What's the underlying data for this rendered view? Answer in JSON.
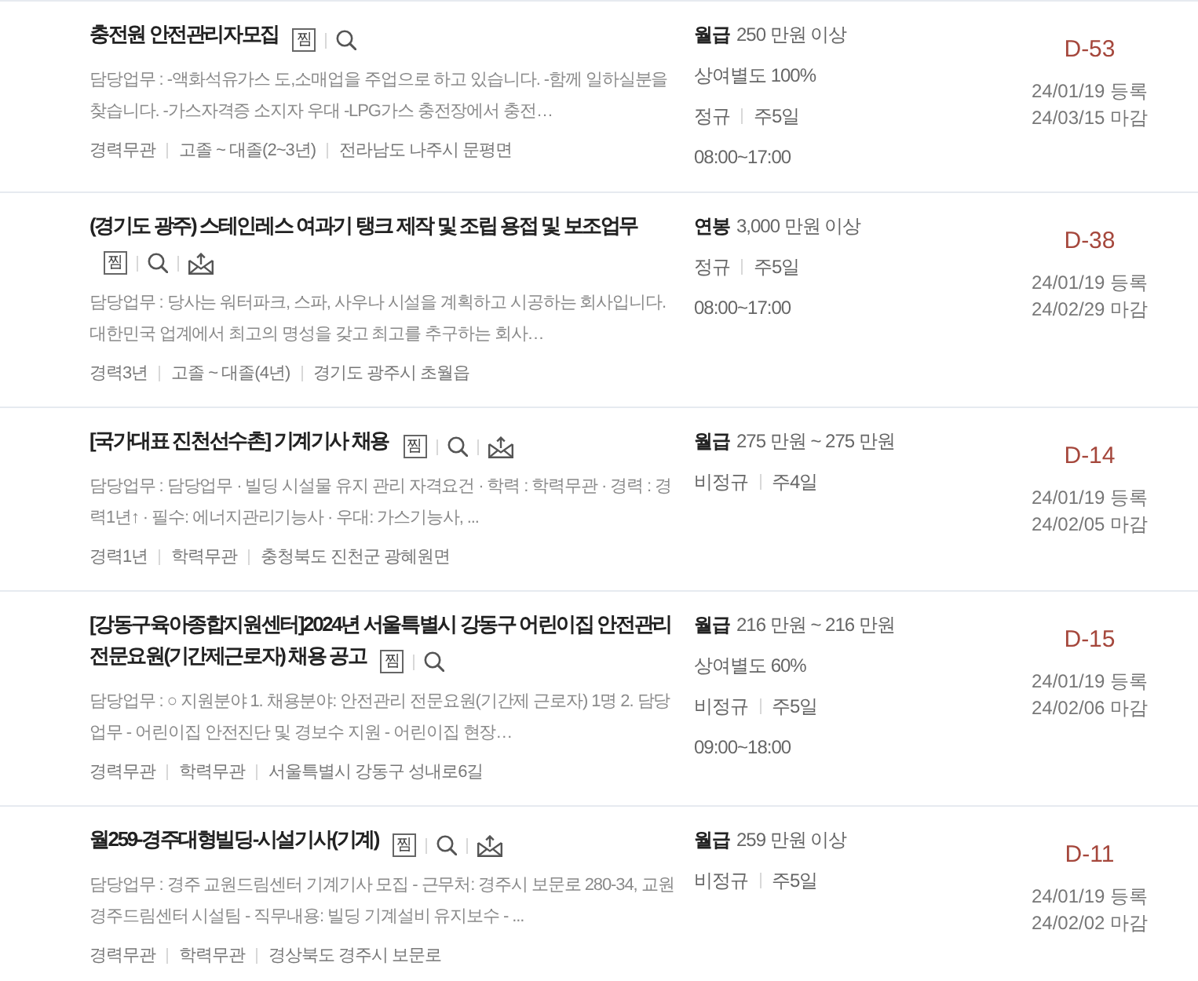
{
  "listings": [
    {
      "title": "충전원 안전관리자모집",
      "actions": [
        {
          "kind": "scrap",
          "label": "찜"
        },
        {
          "kind": "search"
        }
      ],
      "description": "담당업무 : -액화석유가스 도,소매업을 주업으로 하고 있습니다. -함께 일하실분을 찾습니다. -가스자격증 소지자 우대 -LPG가스 충전장에서 충전…",
      "conditions": [
        "경력무관",
        "고졸 ~ 대졸(2~3년)",
        "전라남도 나주시 문평면"
      ],
      "pay": {
        "type": "월급",
        "amount": "250 만원 이상"
      },
      "bonus": "상여별도 100%",
      "employment": [
        "정규",
        "주5일"
      ],
      "hours": "08:00~17:00",
      "d_day": "D-53",
      "registered": "24/01/19 등록",
      "deadline": "24/03/15 마감"
    },
    {
      "title": "(경기도 광주) 스테인레스 여과기 탱크 제작 및 조립 용접 및 보조업무",
      "actions": [
        {
          "kind": "scrap",
          "label": "찜"
        },
        {
          "kind": "search"
        },
        {
          "kind": "mail"
        }
      ],
      "description": "담당업무 : 당사는 워터파크, 스파, 사우나 시설을 계획하고 시공하는 회사입니다. 대한민국 업계에서 최고의 명성을 갖고 최고를 추구하는 회사…",
      "conditions": [
        "경력3년",
        "고졸 ~ 대졸(4년)",
        "경기도 광주시 초월읍"
      ],
      "pay": {
        "type": "연봉",
        "amount": "3,000 만원 이상"
      },
      "employment": [
        "정규",
        "주5일"
      ],
      "hours": "08:00~17:00",
      "d_day": "D-38",
      "registered": "24/01/19 등록",
      "deadline": "24/02/29 마감"
    },
    {
      "title": "[국가대표 진천선수촌] 기계기사 채용",
      "actions": [
        {
          "kind": "scrap",
          "label": "찜"
        },
        {
          "kind": "search"
        },
        {
          "kind": "mail"
        }
      ],
      "description": "담당업무 : 담당업무 · 빌딩 시설물 유지 관리 자격요건 · 학력 : 학력무관 · 경력 : 경력1년↑ · 필수: 에너지관리기능사 · 우대: 가스기능사, ...",
      "conditions": [
        "경력1년",
        "학력무관",
        "충청북도 진천군 광혜원면"
      ],
      "pay": {
        "type": "월급",
        "amount": "275 만원 ~ 275 만원"
      },
      "employment": [
        "비정규",
        "주4일"
      ],
      "d_day": "D-14",
      "registered": "24/01/19 등록",
      "deadline": "24/02/05 마감"
    },
    {
      "title": "[강동구육아종합지원센터]2024년 서울특별시 강동구 어린이집 안전관리 전문요원(기간제근로자) 채용 공고",
      "actions": [
        {
          "kind": "scrap",
          "label": "찜"
        },
        {
          "kind": "search"
        }
      ],
      "description": "담당업무 : ○ 지원분야 1. 채용분야: 안전관리 전문요원(기간제 근로자) 1명 2. 담당업무 - 어린이집 안전진단 및 경보수 지원 - 어린이집 현장…",
      "conditions": [
        "경력무관",
        "학력무관",
        "서울특별시 강동구 성내로6길"
      ],
      "pay": {
        "type": "월급",
        "amount": "216 만원 ~ 216 만원"
      },
      "bonus": "상여별도 60%",
      "employment": [
        "비정규",
        "주5일"
      ],
      "hours": "09:00~18:00",
      "d_day": "D-15",
      "registered": "24/01/19 등록",
      "deadline": "24/02/06 마감"
    },
    {
      "title": "월259-경주대형빌딩-시설기사(기계)",
      "actions": [
        {
          "kind": "scrap",
          "label": "찜"
        },
        {
          "kind": "search"
        },
        {
          "kind": "mail"
        }
      ],
      "description": "담당업무 : 경주 교원드림센터 기계기사 모집 - 근무처: 경주시 보문로 280-34, 교원경주드림센터 시설팀 - 직무내용: 빌딩 기계설비 유지보수 - ...",
      "conditions": [
        "경력무관",
        "학력무관",
        "경상북도 경주시 보문로"
      ],
      "pay": {
        "type": "월급",
        "amount": "259 만원 이상"
      },
      "employment": [
        "비정규",
        "주5일"
      ],
      "d_day": "D-11",
      "registered": "24/01/19 등록",
      "deadline": "24/02/02 마감"
    }
  ]
}
